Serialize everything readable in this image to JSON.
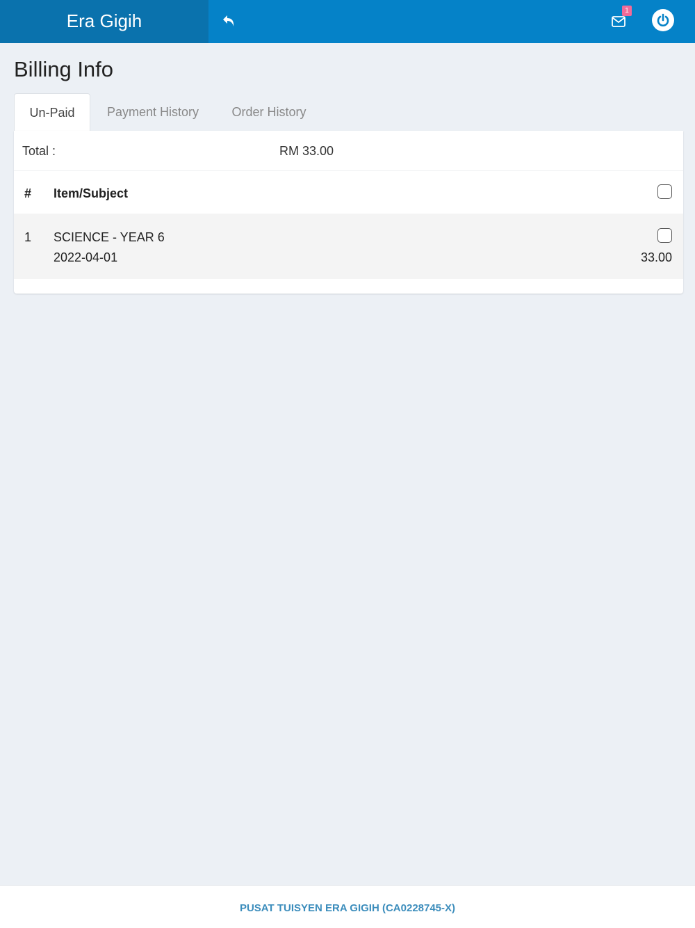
{
  "header": {
    "brand": "Era Gigih",
    "mail_badge_count": "1",
    "icons": [
      "reply-arrow-icon",
      "mail-icon",
      "power-icon"
    ]
  },
  "page": {
    "title": "Billing Info"
  },
  "tabs": [
    {
      "label": "Un-Paid",
      "active": true
    },
    {
      "label": "Payment History",
      "active": false
    },
    {
      "label": "Order History",
      "active": false
    }
  ],
  "summary": {
    "total_label": "Total :",
    "total_value": "RM 33.00"
  },
  "table": {
    "headers": {
      "num": "#",
      "item": "Item/Subject"
    },
    "rows": [
      {
        "num": "1",
        "subject": "SCIENCE - YEAR 6",
        "date": "2022-04-01",
        "amount": "33.00"
      }
    ]
  },
  "footer": {
    "text": "PUSAT TUISYEN ERA GIGIH (CA0228745-X)"
  },
  "colors": {
    "topbar": "#0582c8",
    "brand_bg": "#0a72ad",
    "badge": "#f36a98",
    "footer_text": "#3c8dbc",
    "page_bg": "#ecf0f5"
  }
}
